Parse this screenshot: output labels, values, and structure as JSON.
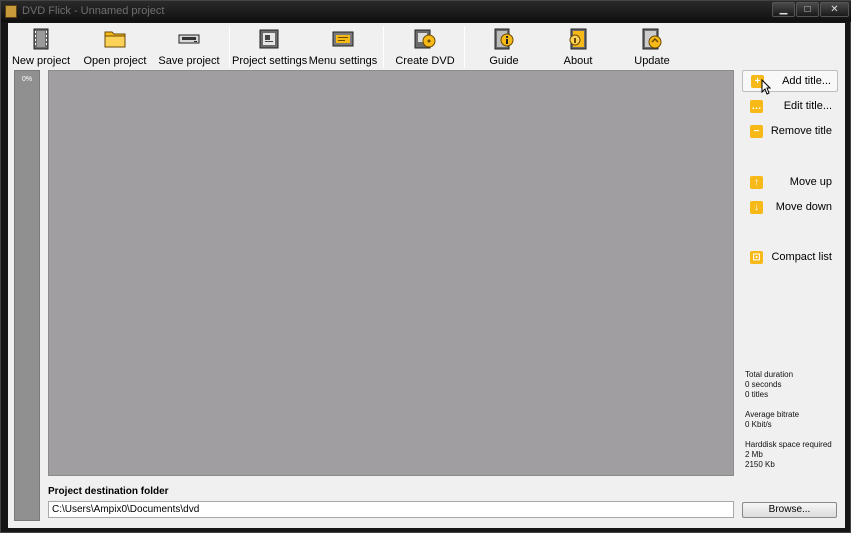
{
  "window": {
    "title": "DVD Flick - Unnamed project",
    "controls": {
      "minimize": "▁",
      "maximize": "□",
      "close": "✕"
    }
  },
  "toolbar": {
    "items": [
      {
        "label": "New project",
        "icon": "new-project-icon"
      },
      {
        "label": "Open project",
        "icon": "folder-icon"
      },
      {
        "label": "Save project",
        "icon": "save-icon"
      },
      {
        "label": "Project settings",
        "icon": "project-settings-icon"
      },
      {
        "label": "Menu settings",
        "icon": "menu-settings-icon"
      },
      {
        "label": "Create DVD",
        "icon": "create-dvd-icon"
      },
      {
        "label": "Guide",
        "icon": "guide-icon"
      },
      {
        "label": "About",
        "icon": "about-icon"
      },
      {
        "label": "Update",
        "icon": "update-icon"
      }
    ]
  },
  "progress": {
    "label": "0%",
    "value": 0
  },
  "sidebar": {
    "add_title": "Add title...",
    "edit_title": "Edit title...",
    "remove_title": "Remove title",
    "move_up": "Move up",
    "move_down": "Move down",
    "compact_list": "Compact list"
  },
  "stats": {
    "total_duration_label": "Total duration",
    "total_duration_value": "0 seconds",
    "titles_count": "0 titles",
    "avg_bitrate_label": "Average bitrate",
    "avg_bitrate_value": "0 Kbit/s",
    "disk_label": "Harddisk space required",
    "disk_mb": "2 Mb",
    "disk_kb": "2150 Kb"
  },
  "destination": {
    "label": "Project destination folder",
    "path": "C:\\Users\\Ampix0\\Documents\\dvd",
    "browse_label": "Browse..."
  },
  "colors": {
    "accent": "#f7b918",
    "list_bg": "#a09ea1",
    "progress_bg": "#909090",
    "window_frame": "#161616"
  }
}
